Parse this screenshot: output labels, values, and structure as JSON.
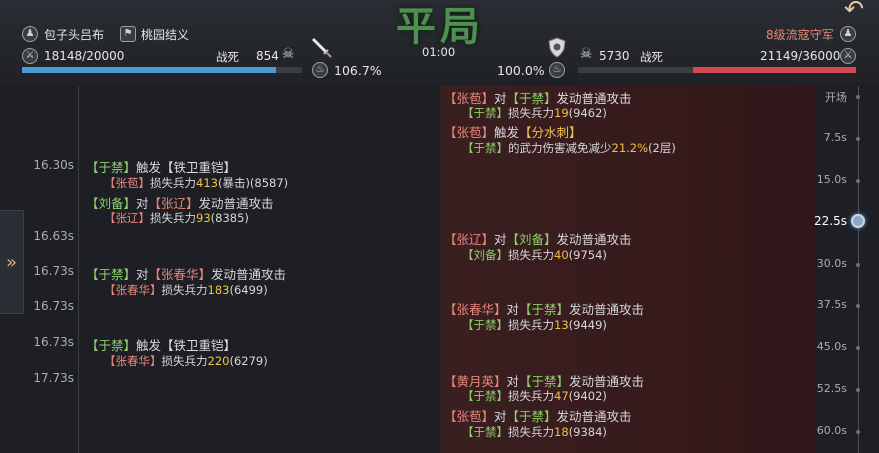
{
  "header": {
    "result": "平局",
    "timer": "01:00",
    "back_icon": "back-arrow-icon",
    "left": {
      "player_name": "包子头吕布",
      "alliance": "桃园结义",
      "troops": "18148/20000",
      "dead_label": "战死",
      "dead_value": "854",
      "morale": "106.7%",
      "bar_fraction": 0.9074,
      "bar_color": "#4a9ad0"
    },
    "right": {
      "enemy_name": "8级流寇守军",
      "troops": "21149/36000",
      "dead_label": "战死",
      "dead_value": "5730",
      "morale": "100.0%",
      "bar_fraction": 0.5875,
      "bar_color": "#d04a4f"
    }
  },
  "timeline": {
    "times": [
      "16.30s",
      "16.63s",
      "16.73s",
      "16.73s",
      "16.73s",
      "17.73s"
    ],
    "ruler": [
      "开场",
      "7.5s",
      "15.0s",
      "22.5s",
      "30.0s",
      "37.5s",
      "45.0s",
      "52.5s",
      "60.0s"
    ],
    "active_ruler": "22.5s"
  },
  "log": {
    "e1": {
      "a": "【张苞】",
      "b": "对",
      "c": "【于禁】",
      "d": "发动普通攻击"
    },
    "e1s": {
      "a": "【于禁】",
      "b": "损失兵力",
      "c": "19",
      "d": "(9462)"
    },
    "e2": {
      "a": "【张苞】",
      "b": "触发",
      "c": "【分水刺】"
    },
    "e2s": {
      "a": "【于禁】",
      "b": "的武力伤害减免减少",
      "c": "21.2%",
      "d": "(2层)"
    },
    "p1": {
      "a": "【于禁】",
      "b": "触发",
      "c": "【铁卫重铠】"
    },
    "p1s": {
      "a": "【张苞】",
      "b": "损失兵力",
      "c": "413",
      "d": "(暴击)(8587)"
    },
    "p2": {
      "a": "【刘备】",
      "b": "对",
      "c": "【张辽】",
      "d": "发动普通攻击"
    },
    "p2s": {
      "a": "【张辽】",
      "b": "损失兵力",
      "c": "93",
      "d": "(8385)"
    },
    "e3": {
      "a": "【张辽】",
      "b": "对",
      "c": "【刘备】",
      "d": "发动普通攻击"
    },
    "e3s": {
      "a": "【刘备】",
      "b": "损失兵力",
      "c": "40",
      "d": "(9754)"
    },
    "p3": {
      "a": "【于禁】",
      "b": "对",
      "c": "【张春华】",
      "d": "发动普通攻击"
    },
    "p3s": {
      "a": "【张春华】",
      "b": "损失兵力",
      "c": "183",
      "d": "(6499)"
    },
    "e4": {
      "a": "【张春华】",
      "b": "对",
      "c": "【于禁】",
      "d": "发动普通攻击"
    },
    "e4s": {
      "a": "【于禁】",
      "b": "损失兵力",
      "c": "13",
      "d": "(9449)"
    },
    "p4": {
      "a": "【于禁】",
      "b": "触发",
      "c": "【铁卫重铠】"
    },
    "p4s": {
      "a": "【张春华】",
      "b": "损失兵力",
      "c": "220",
      "d": "(6279)"
    },
    "e5": {
      "a": "【黄月英】",
      "b": "对",
      "c": "【于禁】",
      "d": "发动普通攻击"
    },
    "e5s": {
      "a": "【于禁】",
      "b": "损失兵力",
      "c": "47",
      "d": "(9402)"
    },
    "e6": {
      "a": "【张苞】",
      "b": "对",
      "c": "【于禁】",
      "d": "发动普通攻击"
    },
    "e6s": {
      "a": "【于禁】",
      "b": "损失兵力",
      "c": "18",
      "d": "(9384)"
    }
  }
}
